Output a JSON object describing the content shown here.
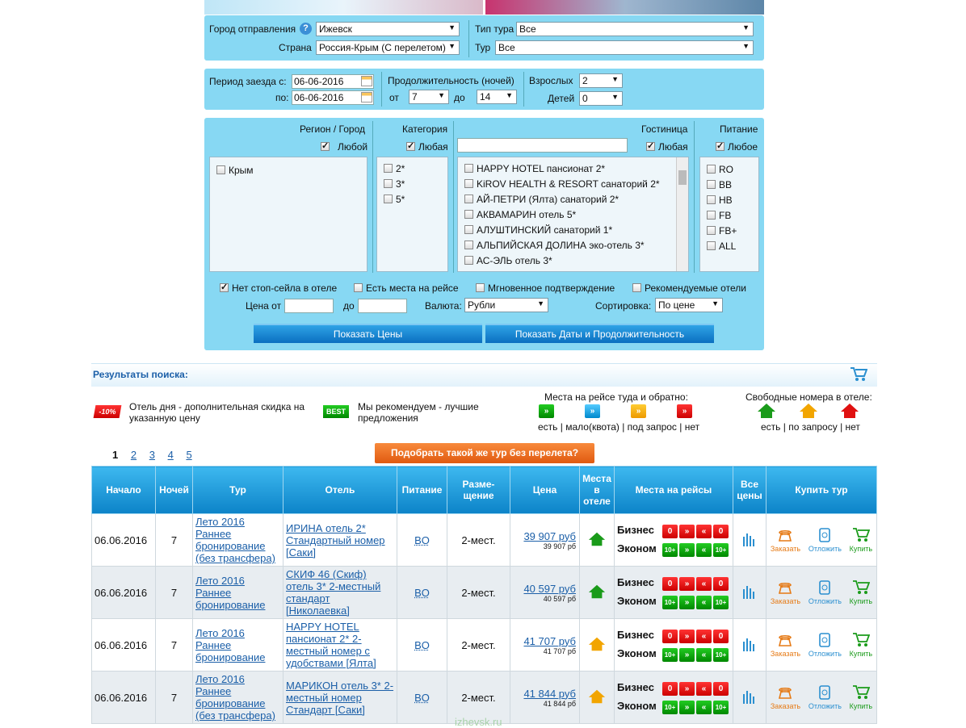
{
  "form1": {
    "city_label": "Город отправления",
    "city": "Ижевск",
    "country_label": "Страна",
    "country": "Россия-Крым (С перелетом)",
    "tour_type_label": "Тип тура",
    "tour_type": "Все",
    "tour_label": "Тур",
    "tour": "Все"
  },
  "form2": {
    "period_label": "Период заезда с:",
    "period_to_label": "по:",
    "date_from": "06-06-2016",
    "date_to": "06-06-2016",
    "duration_label": "Продолжительность (ночей)",
    "from_label": "от",
    "nights_from": "7",
    "to_label": "до",
    "nights_to": "14",
    "adults_label": "Взрослых",
    "adults": "2",
    "children_label": "Детей",
    "children": "0"
  },
  "form3": {
    "region_head": "Регион / Город",
    "region_any": "Любой",
    "category_head": "Категория",
    "category_any": "Любая",
    "hotel_head": "Гостиница",
    "hotel_any": "Любая",
    "meal_head": "Питание",
    "meal_any": "Любое",
    "regions": [
      "Крым"
    ],
    "categories": [
      "2*",
      "3*",
      "5*"
    ],
    "hotels": [
      "HAPPY HOTEL пансионат 2*",
      "KiROV HEALTH & RESORT санаторий 2*",
      "АЙ-ПЕТРИ (Ялта) санаторий 2*",
      "АКВАМАРИН отель 5*",
      "АЛУШТИНСКИЙ санаторий 1*",
      "АЛЬПИЙСКАЯ ДОЛИНА эко-отель 3*",
      "АС-ЭЛЬ отель 3*"
    ],
    "meals": [
      "RO",
      "BB",
      "HB",
      "FB",
      "FB+",
      "ALL"
    ],
    "opt1": "Нет стоп-сейла в отеле",
    "opt2": "Есть места на рейсе",
    "opt3": "Мгновенное подтверждение",
    "opt4": "Рекомендуемые отели",
    "price_from_label": "Цена от",
    "price_to_label": "до",
    "currency_label": "Валюта:",
    "currency": "Рубли",
    "sort_label": "Сортировка:",
    "sort": "По цене",
    "btn_prices": "Показать Цены",
    "btn_dates": "Показать Даты и Продолжительность"
  },
  "results": {
    "title": "Результаты поиска:",
    "hot_badge": "-10%",
    "hot_text": "Отель дня - дополнительная скидка на указанную цену",
    "best_badge": "BEST",
    "best_text": "Мы рекомендуем - лучшие предложения",
    "flight_legend_title": "Места на рейсе туда и обратно:",
    "flight_legend": "есть | мало(квота) | под запрос | нет",
    "room_legend_title": "Свободные номера в отеле:",
    "room_legend": "есть | по запросу | нет",
    "pages": [
      "1",
      "2",
      "3",
      "4",
      "5"
    ],
    "no_flight_btn": "Подобрать такой же тур без перелета?",
    "watermark": "izhevsk.ru"
  },
  "table": {
    "headers": [
      "Начало",
      "Ночей",
      "Тур",
      "Отель",
      "Питание",
      "Разме-щение",
      "Цена",
      "Места в отеле",
      "Места на рейсы",
      "Все цены",
      "Купить тур"
    ],
    "biz": "Бизнес",
    "eco": "Эконом",
    "order": "Заказать",
    "defer": "Отложить",
    "buy": "Купить",
    "rows": [
      {
        "date": "06.06.2016",
        "nights": "7",
        "tour": "Лето 2016 Раннее бронирование (без трансфера)",
        "hotel": "ИРИНА отель 2* Стандартный номер [Саки]",
        "meal": "BO",
        "place": "2-мест.",
        "price": "39 907 руб",
        "price2": "39 907 рб",
        "room": "green"
      },
      {
        "date": "06.06.2016",
        "nights": "7",
        "tour": "Лето 2016 Раннее бронирование",
        "hotel": "СКИФ 46 (Скиф) отель 3* 2-местный стандарт [Николаевка]",
        "meal": "BO",
        "place": "2-мест.",
        "price": "40 597 руб",
        "price2": "40 597 рб",
        "room": "green"
      },
      {
        "date": "06.06.2016",
        "nights": "7",
        "tour": "Лето 2016 Раннее бронирование",
        "hotel": "HAPPY HOTEL пансионат 2* 2-местный номер с удобствами [Ялта]",
        "meal": "BO",
        "place": "2-мест.",
        "price": "41 707 руб",
        "price2": "41 707 рб",
        "room": "orange"
      },
      {
        "date": "06.06.2016",
        "nights": "7",
        "tour": "Лето 2016 Раннее бронирование (без трансфера)",
        "hotel": "МАРИКОН отель 3* 2-местный номер Стандарт [Саки]",
        "meal": "BO",
        "place": "2-мест.",
        "price": "41 844 руб",
        "price2": "41 844 рб",
        "room": "orange"
      }
    ]
  },
  "colors": {
    "panel": "#87d8f3",
    "header": "#0c83c8",
    "link": "#1b5fa8"
  }
}
